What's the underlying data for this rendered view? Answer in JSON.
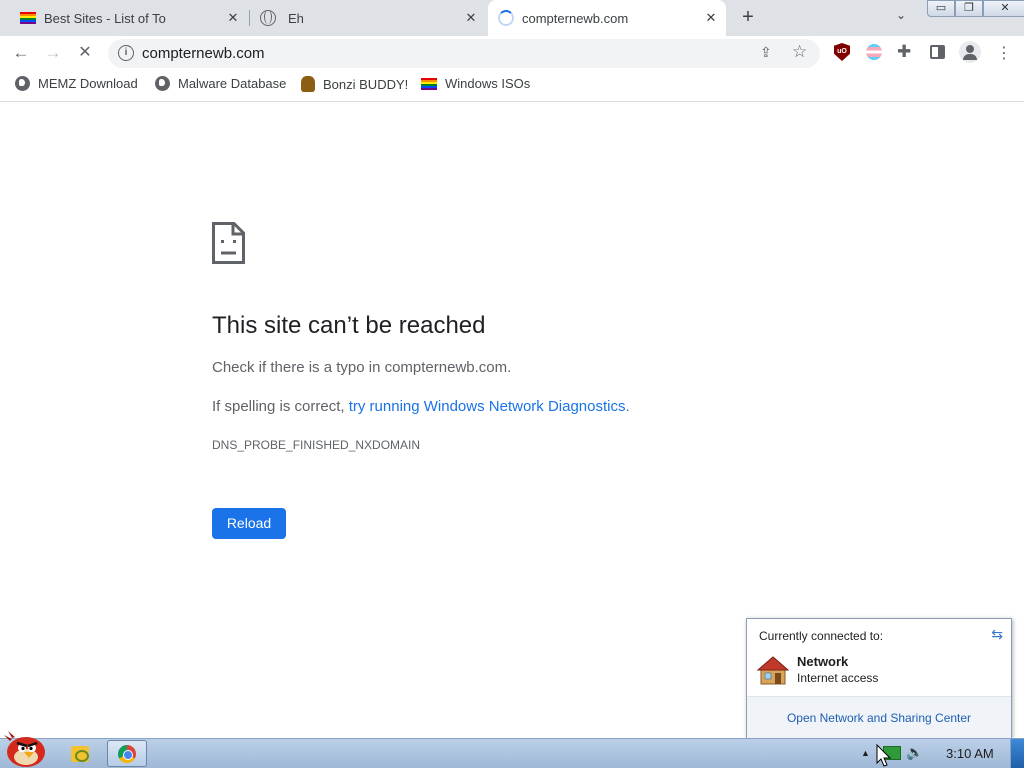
{
  "tabs": [
    {
      "title": "Best Sites - List of To",
      "favicon": "rainbow-flag-icon",
      "active": false
    },
    {
      "title": "Eh",
      "favicon": "globe-icon",
      "active": false
    },
    {
      "title": "compternewb.com",
      "favicon": "loading-spinner-icon",
      "active": true
    }
  ],
  "tab_close_glyph": "✕",
  "new_tab_glyph": "+",
  "tab_search_glyph": "⌄",
  "window_controls": {
    "minimize": "▭",
    "maximize": "❐",
    "close": "✕"
  },
  "toolbar": {
    "back_glyph": "←",
    "forward_glyph": "→",
    "stop_glyph": "✕",
    "url": "compternewb.com",
    "info_glyph": "i",
    "share_glyph": "⇪",
    "star_glyph": "☆",
    "extensions": [
      "ublock-origin-icon",
      "trans-flag-extension-icon",
      "puzzle-extensions-icon"
    ],
    "ublock_text": "uO",
    "puzzle_glyph": "✚",
    "menu_glyph": "⋮"
  },
  "bookmarks": [
    {
      "label": "MEMZ Download",
      "icon": "globe-icon"
    },
    {
      "label": "Malware Database",
      "icon": "globe-icon"
    },
    {
      "label": "Bonzi BUDDY!",
      "icon": "bonzi-icon"
    },
    {
      "label": "Windows ISOs",
      "icon": "rainbow-flag-icon"
    }
  ],
  "error_page": {
    "title": "This site can’t be reached",
    "line1": "Check if there is a typo in compternewb.com.",
    "line2_prefix": "If spelling is correct, ",
    "line2_link": "try running Windows Network Diagnostics",
    "line2_suffix": ".",
    "error_code": "DNS_PROBE_FINISHED_NXDOMAIN",
    "reload_label": "Reload"
  },
  "network_popup": {
    "header": "Currently connected to:",
    "network_name": "Network",
    "network_status": "Internet access",
    "footer_link": "Open Network and Sharing Center",
    "refresh_glyph": "⇆"
  },
  "taskbar": {
    "clock": "3:10 AM",
    "tray_up_glyph": "▲",
    "volume_glyph": "🔈"
  },
  "colors": {
    "accent": "#1a73e8",
    "tab_strip": "#dee1e6",
    "taskbar": "#bcd0e8"
  }
}
